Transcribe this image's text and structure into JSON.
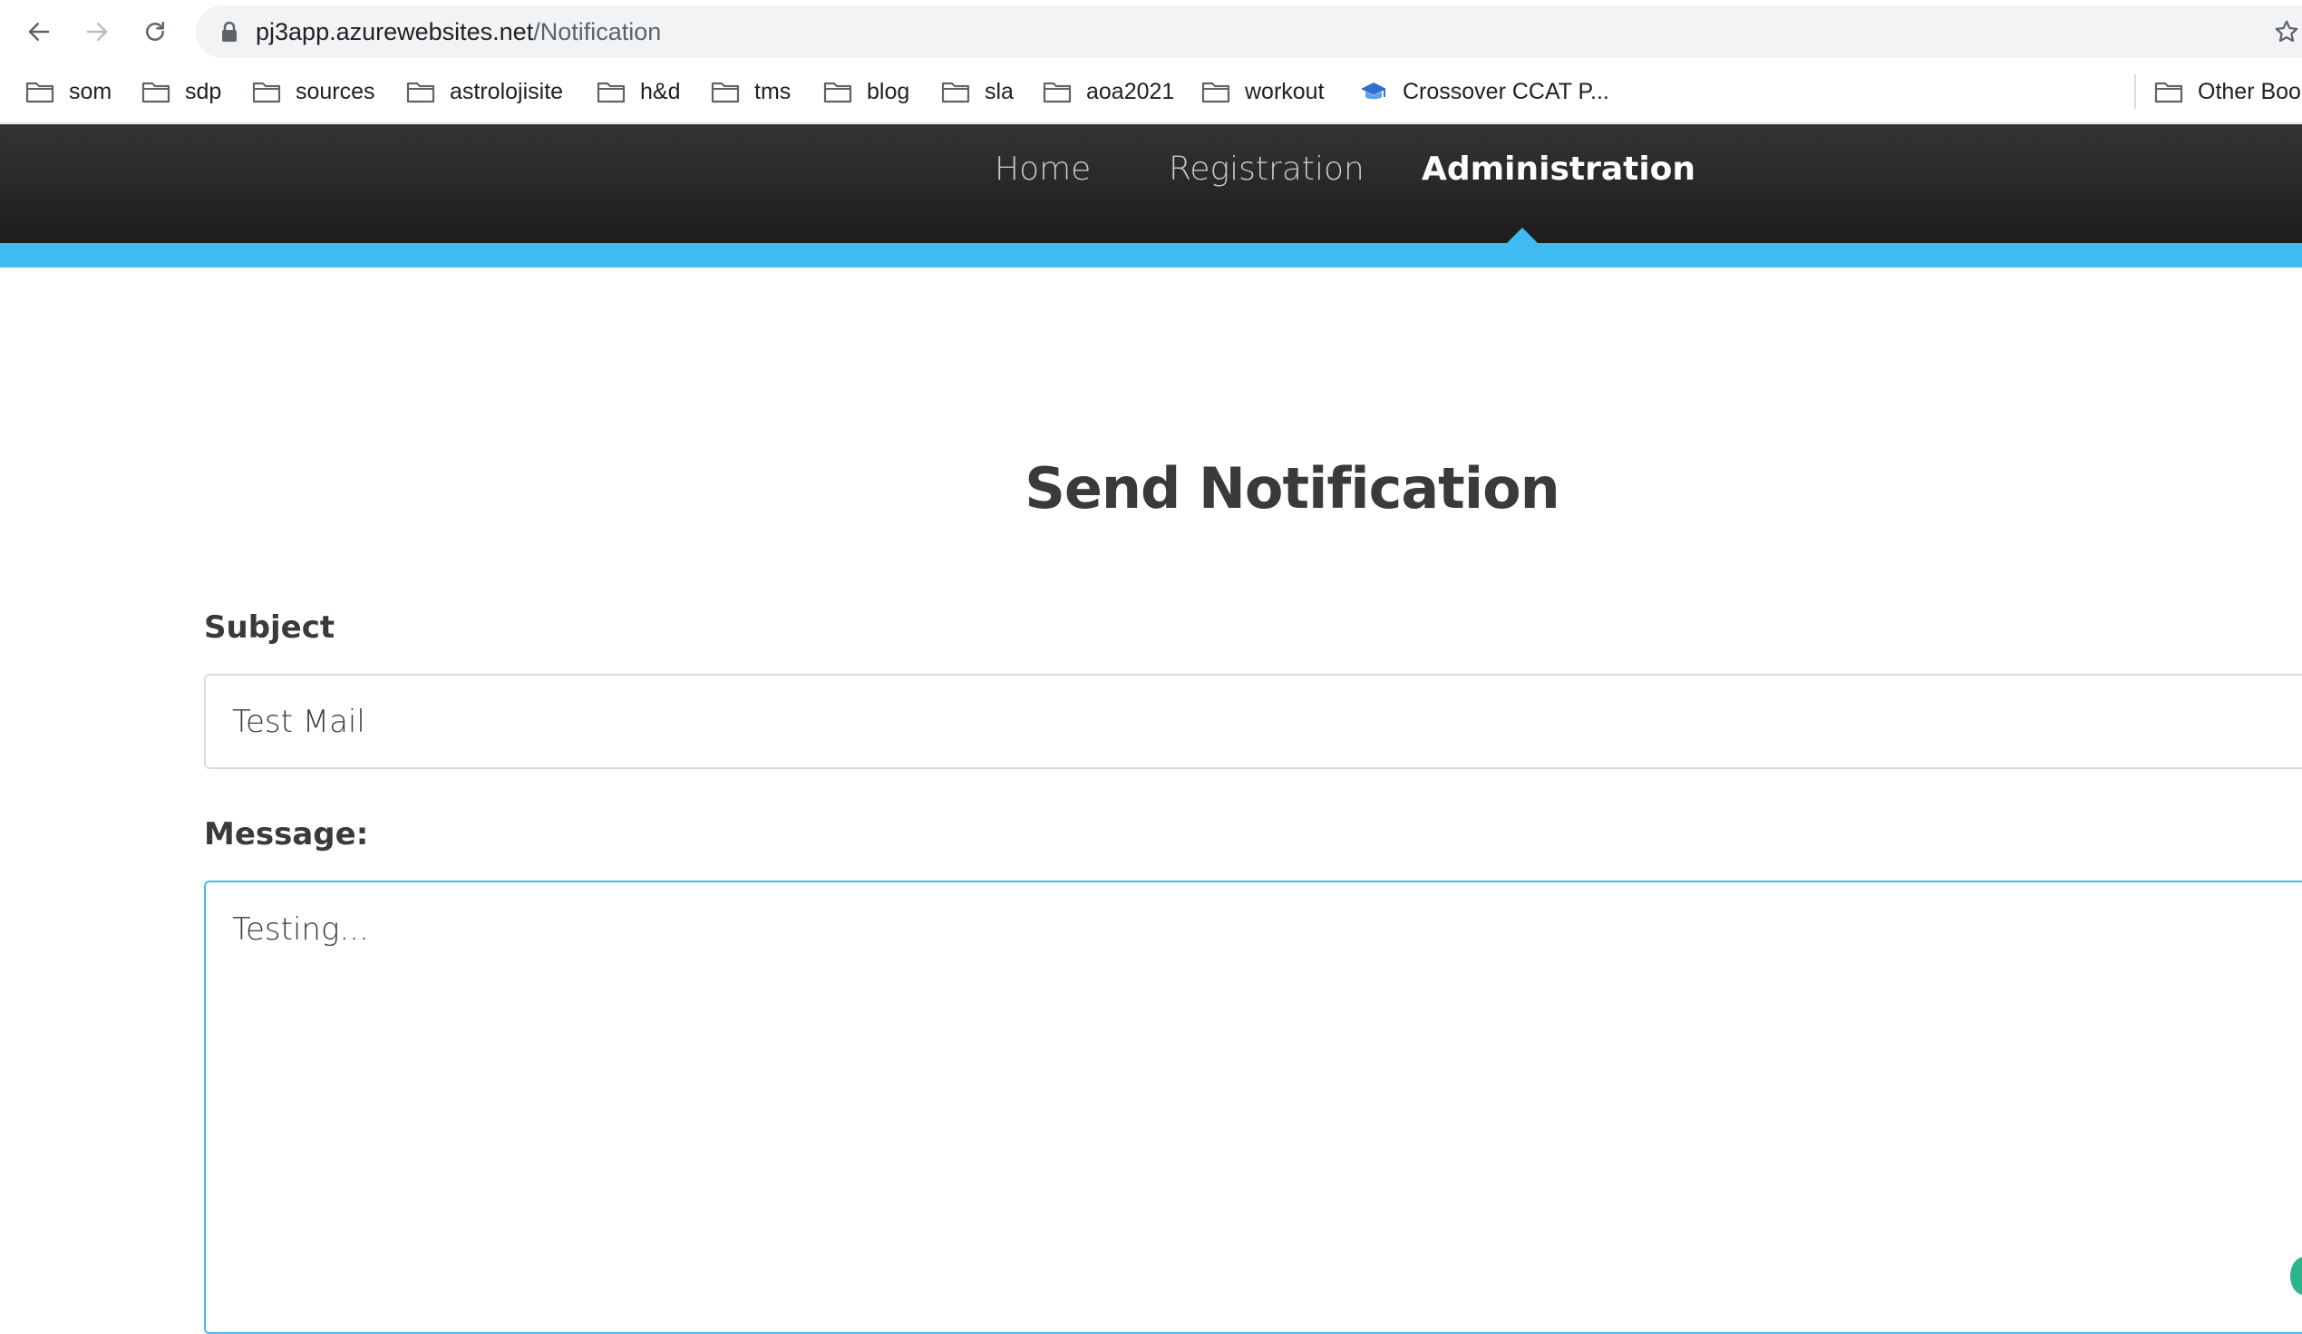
{
  "browser": {
    "url_host": "pj3app.azurewebsites.net",
    "url_path": "/Notification",
    "bookmarks": [
      {
        "label": "som",
        "icon": "folder-icon"
      },
      {
        "label": "sdp",
        "icon": "folder-icon"
      },
      {
        "label": "sources",
        "icon": "folder-icon"
      },
      {
        "label": "astrolojisite",
        "icon": "folder-icon"
      },
      {
        "label": "h&d",
        "icon": "folder-icon"
      },
      {
        "label": "tms",
        "icon": "folder-icon"
      },
      {
        "label": "blog",
        "icon": "folder-icon"
      },
      {
        "label": "sla",
        "icon": "folder-icon"
      },
      {
        "label": "aoa2021",
        "icon": "folder-icon"
      },
      {
        "label": "workout",
        "icon": "folder-icon"
      },
      {
        "label": "Crossover CCAT P...",
        "icon": "graduation-cap-icon"
      }
    ],
    "other_bookmarks": "Other Boo"
  },
  "site_nav": {
    "items": [
      {
        "label": "Home",
        "active": false
      },
      {
        "label": "Registration",
        "active": false
      },
      {
        "label": "Administration",
        "active": true
      }
    ],
    "accent_color": "#3fbbf2"
  },
  "page": {
    "title": "Send Notification",
    "subject_label": "Subject",
    "subject_value": "Test Mail",
    "message_label": "Message:",
    "message_value": "Testing..."
  }
}
